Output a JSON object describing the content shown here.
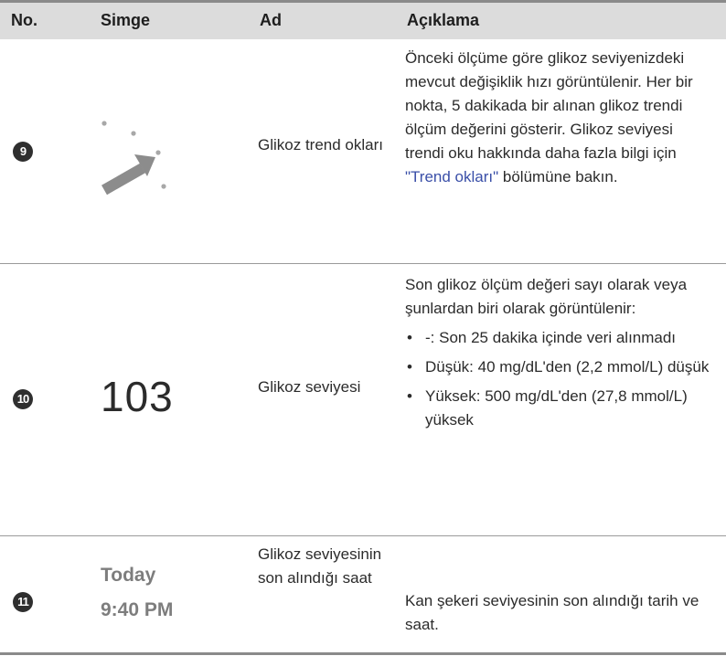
{
  "header": {
    "no": "No.",
    "simge": "Simge",
    "ad": "Ad",
    "aciklama": "Açıklama"
  },
  "rows": [
    {
      "number": "9",
      "icon": "trend-arrow-icon",
      "name": "Glikoz trend okları",
      "desc_before": "Önceki ölçüme göre glikoz seviyenizdeki mevcut değişiklik hızı görüntülenir. Her bir nokta, 5 dakikada bir alınan glikoz trendi ölçüm değerini gösterir. Glikoz seviyesi trendi oku hakkında daha fazla bilgi için ",
      "desc_link": "\"Trend okları\"",
      "desc_after": " bölümüne bakın."
    },
    {
      "number": "10",
      "symbol": "103",
      "name": "Glikoz seviyesi",
      "desc": "Son glikoz ölçüm değeri sayı olarak veya şunlardan biri olarak görüntülenir:",
      "bullets": [
        "-: Son 25 dakika içinde veri alınmadı",
        "Düşük: 40 mg/dL'den (2,2 mmol/L) düşük",
        "Yüksek: 500 mg/dL'den (27,8 mmol/L) yüksek"
      ]
    },
    {
      "number": "11",
      "symbol_line1": "Today",
      "symbol_line2": "9:40 PM",
      "name": "Glikoz seviyesinin son alındığı saat",
      "desc": "Kan şekeri seviyesinin son alındığı tarih ve saat."
    }
  ],
  "colors": {
    "header_bg": "#dcdcdc",
    "link": "#3a4fa8",
    "time_gray": "#7d7d7d"
  }
}
